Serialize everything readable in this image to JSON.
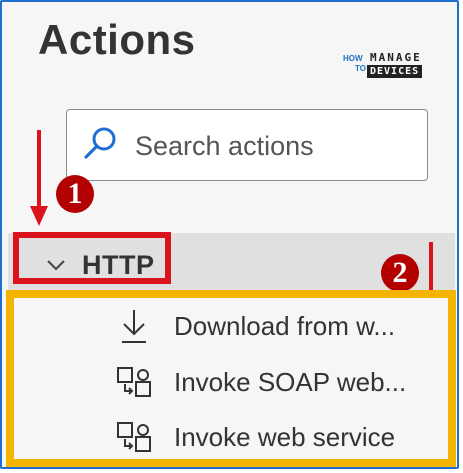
{
  "panel": {
    "title": "Actions"
  },
  "logo": {
    "how": "HOW",
    "to": "TO",
    "manage": "MANAGE",
    "devices": "DEVICES"
  },
  "search": {
    "placeholder": "Search actions",
    "icon": "search-icon"
  },
  "group": {
    "label": "HTTP",
    "icon": "chevron-down-icon",
    "expanded": true
  },
  "actions": [
    {
      "label": "Download from w...",
      "icon": "download-icon"
    },
    {
      "label": "Invoke SOAP web...",
      "icon": "web-service-icon"
    },
    {
      "label": "Invoke web service",
      "icon": "web-service-icon"
    }
  ],
  "annotations": {
    "badge1": "1",
    "badge2": "2",
    "colors": {
      "badge": "#b30000",
      "http_highlight": "#d9141c",
      "actions_highlight": "#f5b400",
      "frame": "#1f6fd1",
      "search_icon": "#1f6fd1"
    }
  }
}
